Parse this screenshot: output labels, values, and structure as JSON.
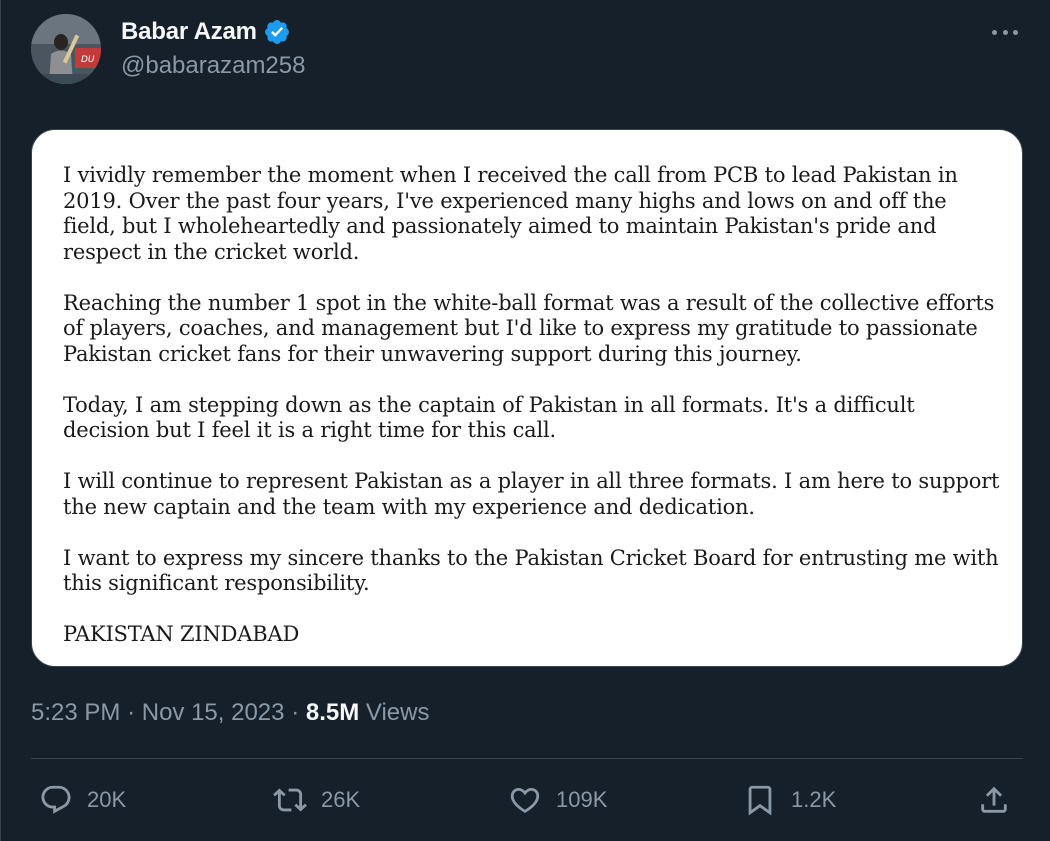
{
  "author": {
    "display_name": "Babar Azam",
    "handle": "@babarazam258",
    "verified": true,
    "avatar_icon": "profile-photo"
  },
  "statement": {
    "paragraphs": [
      "I vividly remember the moment when I received the call from PCB to lead Pakistan in 2019. Over the past four years, I've experienced many highs and lows on and off the field, but I wholeheartedly and passionately aimed to maintain Pakistan's pride and respect in the cricket world.",
      "Reaching the number 1 spot in the white-ball format was a result of the collective efforts of players, coaches, and management but I'd like to express my gratitude to passionate Pakistan cricket fans for their unwavering support during this journey.",
      "Today, I am stepping down as the captain of Pakistan in all formats. It's a difficult decision but I feel it is a right time for this call.",
      "I will continue to represent Pakistan as a player in all three formats. I am here to support the new captain and the team with my experience and dedication.",
      "I want to express my sincere thanks to the Pakistan Cricket Board for entrusting me with this significant responsibility.",
      "PAKISTAN ZINDABAD"
    ]
  },
  "meta": {
    "time": "5:23 PM",
    "separator": "·",
    "date": "Nov 15, 2023",
    "views_count": "8.5M",
    "views_label": "Views"
  },
  "actions": {
    "replies": "20K",
    "reposts": "26K",
    "likes": "109K",
    "bookmarks": "1.2K"
  },
  "colors": {
    "background": "#15202b",
    "text_primary": "#f7f9f9",
    "text_secondary": "#8b98a5",
    "verified_blue": "#1d9bf0",
    "border": "#38444d"
  }
}
